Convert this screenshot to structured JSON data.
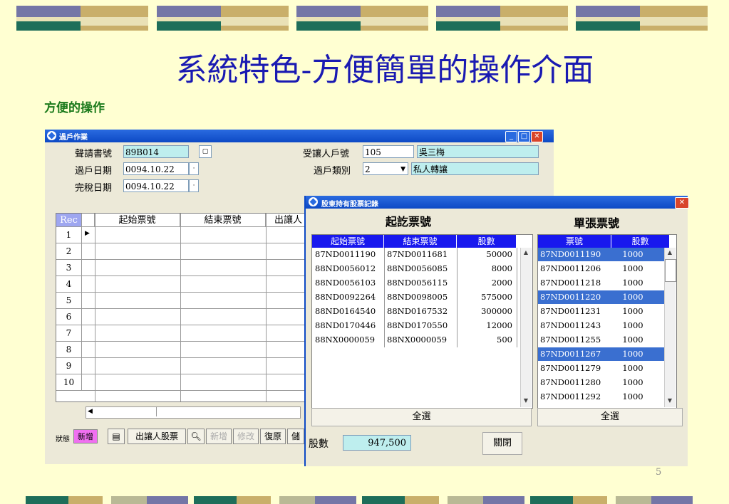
{
  "slide": {
    "title": "系統特色-方便簡單的操作介面",
    "subtitle": "方便的操作",
    "page_number": "5"
  },
  "main_window": {
    "title": "過戶作業",
    "fields": {
      "application_no_label": "聲請書號",
      "application_no_value": "89B014",
      "transfer_date_label": "過戶日期",
      "transfer_date_value": "0094.10.22",
      "tax_date_label": "完稅日期",
      "tax_date_value": "0094.10.22",
      "transferee_no_label": "受讓人戶號",
      "transferee_no_value": "105",
      "transferee_name": "吳三梅",
      "transfer_type_label": "過戶類別",
      "transfer_type_value": "2",
      "transfer_type_name": "私人轉讓"
    },
    "grid": {
      "headers": [
        "Rec",
        "起始票號",
        "結束票號",
        "出讓人"
      ],
      "rows": [
        "1",
        "2",
        "3",
        "4",
        "5",
        "6",
        "7",
        "8",
        "9",
        "10"
      ]
    },
    "toolbar": {
      "status_label": "狀態",
      "status_value": "新增",
      "transferor_stock_button": "出讓人股票",
      "add_button": "新增",
      "modify_button": "修改",
      "restore_button": "復原",
      "save_button": "儲"
    }
  },
  "dialog": {
    "title": "股東持有股票記錄",
    "left_section_title": "起訖票號",
    "right_section_title": "單張票號",
    "left_headers": [
      "起始票號",
      "結束票號",
      "股數"
    ],
    "left_rows": [
      [
        "87ND0011190",
        "87ND0011681",
        "50000"
      ],
      [
        "88ND0056012",
        "88ND0056085",
        "8000"
      ],
      [
        "88ND0056103",
        "88ND0056115",
        "2000"
      ],
      [
        "88ND0092264",
        "88ND0098005",
        "575000"
      ],
      [
        "88ND0164540",
        "88ND0167532",
        "300000"
      ],
      [
        "88ND0170446",
        "88ND0170550",
        "12000"
      ],
      [
        "88NX0000059",
        "88NX0000059",
        "500"
      ]
    ],
    "right_headers": [
      "票號",
      "股數"
    ],
    "right_rows": [
      {
        "ticket": "87ND0011190",
        "shares": "1000",
        "selected": true
      },
      {
        "ticket": "87ND0011206",
        "shares": "1000",
        "selected": false
      },
      {
        "ticket": "87ND0011218",
        "shares": "1000",
        "selected": false
      },
      {
        "ticket": "87ND0011220",
        "shares": "1000",
        "selected": true
      },
      {
        "ticket": "87ND0011231",
        "shares": "1000",
        "selected": false
      },
      {
        "ticket": "87ND0011243",
        "shares": "1000",
        "selected": false
      },
      {
        "ticket": "87ND0011255",
        "shares": "1000",
        "selected": false
      },
      {
        "ticket": "87ND0011267",
        "shares": "1000",
        "selected": true
      },
      {
        "ticket": "87ND0011279",
        "shares": "1000",
        "selected": false
      },
      {
        "ticket": "87ND0011280",
        "shares": "1000",
        "selected": false
      },
      {
        "ticket": "87ND0011292",
        "shares": "1000",
        "selected": false
      }
    ],
    "select_all_left": "全選",
    "select_all_right": "全選",
    "shares_label": "股數",
    "shares_total": "947,500",
    "close_button": "關閉"
  }
}
